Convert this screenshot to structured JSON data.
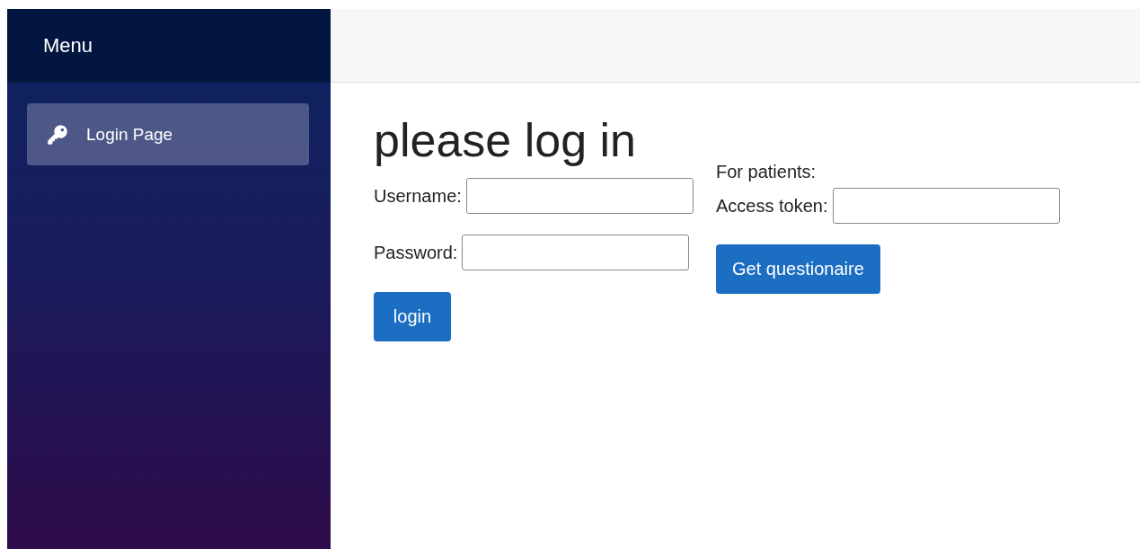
{
  "sidebar": {
    "title": "Menu",
    "items": [
      {
        "label": "Login Page",
        "selected": true
      }
    ]
  },
  "main": {
    "heading": "please log in",
    "login_form": {
      "fields": [
        {
          "label": "Username:"
        },
        {
          "label": "Password:"
        }
      ],
      "button": "login"
    },
    "patient_form": {
      "note": "For patients:",
      "fields": [
        {
          "label": "Access token:"
        }
      ],
      "button": "Get questionaire"
    }
  }
}
